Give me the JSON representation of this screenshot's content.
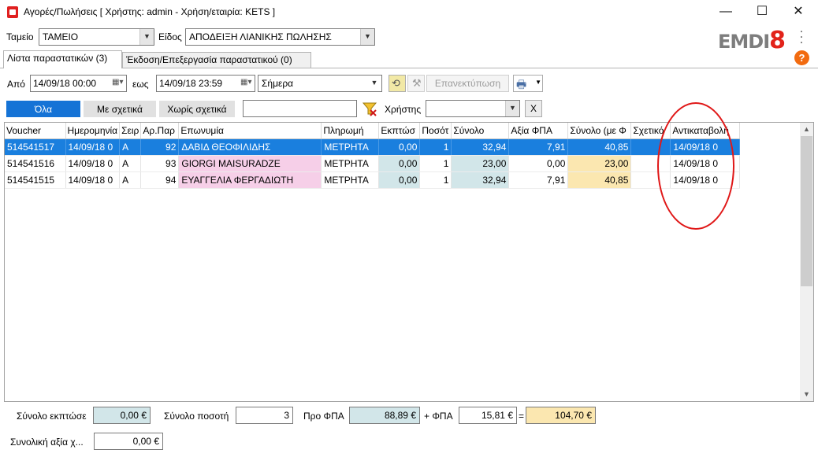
{
  "window": {
    "title": "Αγορές/Πωλήσεις  [ Χρήστης: admin - Χρήση/εταιρία: KETS ]",
    "minimize": "—",
    "maximize": "☐",
    "close": "✕"
  },
  "header": {
    "tameio_label": "Ταμείο",
    "tameio_value": "ΤΑΜΕΙΟ",
    "eidos_label": "Είδος",
    "eidos_value": "ΑΠΟΔΕΙΞΗ ΛΙΑΝΙΚΗΣ ΠΩΛΗΣΗΣ",
    "logo_text": "EMDI",
    "logo_number": "8",
    "help": "?"
  },
  "tabs": [
    {
      "label": "Λίστα παραστατικών (3)",
      "active": true
    },
    {
      "label": "Έκδοση/Επεξεργασία παραστατικού (0)",
      "active": false
    }
  ],
  "filters": {
    "from_label": "Από",
    "from_value": "14/09/18 00:00",
    "to_label": "εως",
    "to_value": "14/09/18 23:59",
    "period_value": "Σήμερα",
    "reprint_label": "Επανεκτύπωση",
    "seg_all": "Όλα",
    "seg_related": "Με σχετικά",
    "seg_unrelated": "Χωρίς σχετικά",
    "search_value": "",
    "user_label": "Χρήστης",
    "user_value": "",
    "clear_label": "X"
  },
  "grid": {
    "columns": [
      "Voucher",
      "Ημερομηνία",
      "Σειρ",
      "Αρ.Παρ",
      "Επωνυμία",
      "Πληρωμή",
      "Εκπτώσ",
      "Ποσότ",
      "Σύνολο",
      "Αξία ΦΠΑ",
      "Σύνολο (με Φ",
      "Σχετικό",
      "Αντικαταβολή"
    ],
    "rows": [
      {
        "voucher": "514541517",
        "date": "14/09/18 0",
        "series": "A",
        "number": "92",
        "name": "ΔΑΒΙΔ ΘΕΟΦΙΛΙΔΗΣ",
        "payment": "ΜΕΤΡΗΤΑ",
        "discount": "0,00",
        "qty": "1",
        "total": "32,94",
        "vat": "7,91",
        "total_vat": "40,85",
        "related": "",
        "cod": "14/09/18 0"
      },
      {
        "voucher": "514541516",
        "date": "14/09/18 0",
        "series": "A",
        "number": "93",
        "name": "GIORGI MAISURADZE",
        "payment": "ΜΕΤΡΗΤΑ",
        "discount": "0,00",
        "qty": "1",
        "total": "23,00",
        "vat": "0,00",
        "total_vat": "23,00",
        "related": "",
        "cod": "14/09/18 0"
      },
      {
        "voucher": "514541515",
        "date": "14/09/18 0",
        "series": "A",
        "number": "94",
        "name": "ΕΥΑΓΓΕΛΙΑ ΦΕΡΓΑΔΙΩΤΗ",
        "payment": "ΜΕΤΡΗΤΑ",
        "discount": "0,00",
        "qty": "1",
        "total": "32,94",
        "vat": "7,91",
        "total_vat": "40,85",
        "related": "",
        "cod": "14/09/18 0"
      }
    ],
    "selected_row": 0
  },
  "footer": {
    "discount_label": "Σύνολο εκπτώσε",
    "discount_value": "0,00 €",
    "qty_label": "Σύνολο ποσοτή",
    "qty_value": "3",
    "pre_vat_label": "Προ ΦΠΑ",
    "pre_vat_value": "88,89 €",
    "plus_vat_label": "+ ΦΠΑ",
    "vat_value": "15,81 €",
    "equals": "=",
    "grand_total": "104,70 €",
    "total_value_label": "Συνολική αξία χ...",
    "total_value": "0,00 €"
  },
  "colors": {
    "selection": "#1a7fde",
    "accent_blue": "#1573d6",
    "pink_cell": "#f6cfe8",
    "blue_cell": "#d2e6e9",
    "yellow_cell": "#fbe7b0",
    "annotation": "#e01818",
    "logo_red": "#e2231a"
  }
}
